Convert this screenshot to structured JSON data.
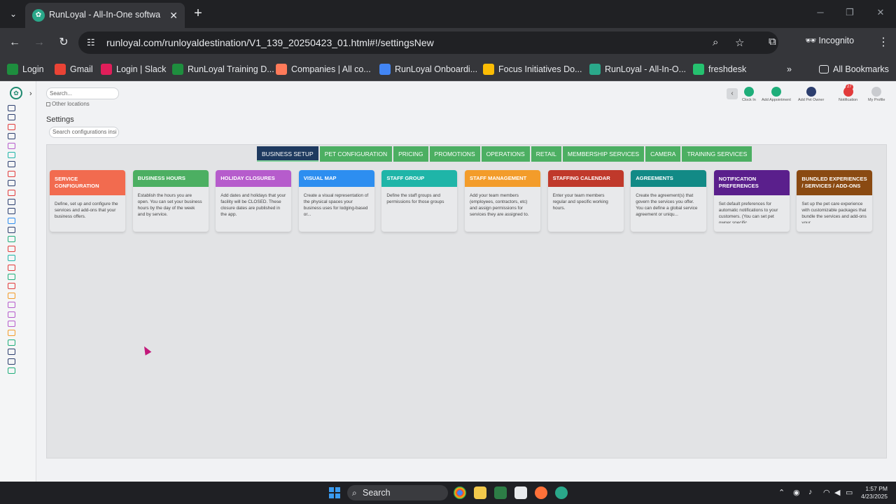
{
  "browser": {
    "tab_title": "RunLoyal - All-In-One software",
    "url": "runloyal.com/runloyaldestination/V1_139_20250423_01.html#!/settingsNew",
    "incognito_label": "Incognito",
    "bookmarks": [
      {
        "label": "Login",
        "color": "#1e8e3e"
      },
      {
        "label": "Gmail",
        "color": "#ea4335"
      },
      {
        "label": "Login | Slack",
        "color": "#e01e5a"
      },
      {
        "label": "RunLoyal Training D...",
        "color": "#1e8e3e"
      },
      {
        "label": "Companies | All co...",
        "color": "#ff7a59"
      },
      {
        "label": "RunLoyal Onboardi...",
        "color": "#4285f4"
      },
      {
        "label": "Focus Initiatives Do...",
        "color": "#fbbc04"
      },
      {
        "label": "RunLoyal - All-In-O...",
        "color": "#2aa88a"
      },
      {
        "label": "freshdesk",
        "color": "#25c16f"
      }
    ],
    "all_bookmarks_label": "All Bookmarks"
  },
  "app": {
    "search_placeholder": "Search...",
    "other_locations_label": "Other locations",
    "page_title": "Settings",
    "config_search_placeholder": "Search configurations insi",
    "header_actions": [
      {
        "label": "Clock In",
        "color": "#1fae7a"
      },
      {
        "label": "Add Appointment",
        "color": "#1fae7a"
      },
      {
        "label": "Add Pet Owner",
        "color": "#2c3e6e"
      },
      {
        "label": "Notification",
        "color": "#e23b3b",
        "badge": "27"
      },
      {
        "label": "My Profile",
        "color": "#c9cbcf"
      }
    ],
    "settings_tabs": [
      {
        "label": "BUSINESS SETUP",
        "active": true
      },
      {
        "label": "PET CONFIGURATION",
        "active": false
      },
      {
        "label": "PRICING",
        "active": false
      },
      {
        "label": "PROMOTIONS",
        "active": false
      },
      {
        "label": "OPERATIONS",
        "active": false
      },
      {
        "label": "RETAIL",
        "active": false
      },
      {
        "label": "MEMBERSHIP SERVICES",
        "active": false
      },
      {
        "label": "CAMERA",
        "active": false
      },
      {
        "label": "TRAINING SERVICES",
        "active": false
      }
    ],
    "cards": [
      {
        "title": "SERVICE CONFIGURATION",
        "color": "#f26b4f",
        "desc": "Define, set up and configure the services and add-ons that your business offers."
      },
      {
        "title": "BUSINESS HOURS",
        "color": "#4caf62",
        "desc": "Establish the hours you are open. You can set your business hours by the day of the week and by service."
      },
      {
        "title": "HOLIDAY CLOSURES",
        "color": "#b65ccc",
        "desc": "Add dates and holidays that your facility will be CLOSED. These closure dates are published in the app."
      },
      {
        "title": "VISUAL MAP",
        "color": "#2d8ef0",
        "desc": "Create a visual representation of the physical spaces your business uses for lodging-based or..."
      },
      {
        "title": "STAFF GROUP",
        "color": "#1fb5a8",
        "desc": "Define the staff groups and permissions for those groups"
      },
      {
        "title": "STAFF MANAGEMENT",
        "color": "#f39c2a",
        "desc": "Add your team members (employees, contractors, etc) and assign permissions for services they are assigned to."
      },
      {
        "title": "STAFFING CALENDAR",
        "color": "#c0392b",
        "desc": "Enter your team members regular and specific working hours."
      },
      {
        "title": "AGREEMENTS",
        "color": "#128a86",
        "desc": "Create the agreement(s) that govern the services you offer. You can define a global service agreement or uniqu..."
      },
      {
        "title": "NOTIFICATION PREFERENCES",
        "color": "#5a1f8c",
        "desc": "Set default preferences for automatic notifications to your customers. (You can set pet owner specific..."
      },
      {
        "title": "BUNDLED EXPERIENCES / SERVICES / ADD-ONS",
        "color": "#8a4a12",
        "desc": "Set up the pet care experience with customizable packages that bundle the services and add-ons your..."
      }
    ]
  },
  "taskbar": {
    "search_label": "Search",
    "time": "1:57 PM",
    "date": "4/23/2025"
  }
}
